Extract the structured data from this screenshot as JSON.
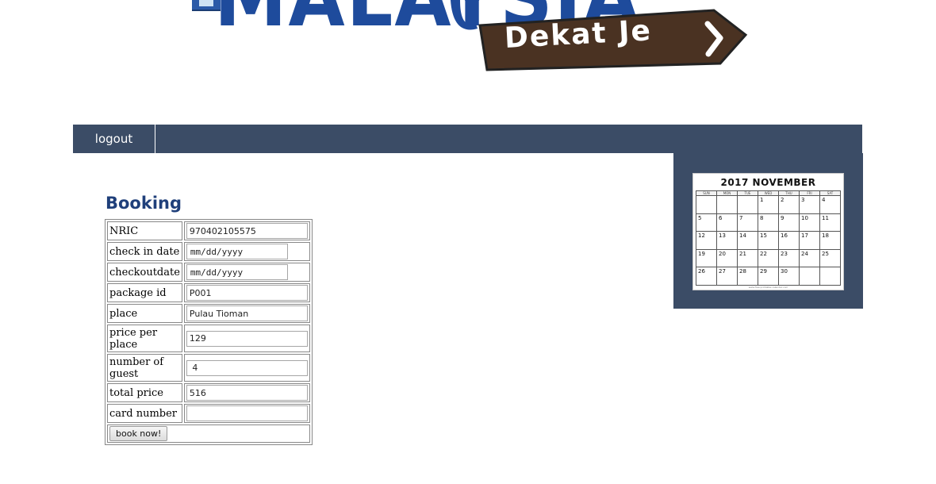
{
  "header": {
    "logo_text": "MALAYSIA",
    "sign_text": "Dekat Je"
  },
  "colors": {
    "nav_bg": "#3b4c66",
    "logo_blue": "#1e4b9c",
    "sign_brown": "#4a3222",
    "title_blue": "#1f3f7a"
  },
  "nav": {
    "items": [
      {
        "label": "logout"
      }
    ]
  },
  "sidebar": {
    "calendar": {
      "title": "2017 NOVEMBER",
      "weekdays": [
        "SUN",
        "MON",
        "TUE",
        "WED",
        "THU",
        "FRI",
        "SAT"
      ],
      "weeks": [
        [
          "",
          "",
          "",
          "1",
          "2",
          "3",
          "4"
        ],
        [
          "5",
          "6",
          "7",
          "8",
          "9",
          "10",
          "11"
        ],
        [
          "12",
          "13",
          "14",
          "15",
          "16",
          "17",
          "18"
        ],
        [
          "19",
          "20",
          "21",
          "22",
          "23",
          "24",
          "25"
        ],
        [
          "26",
          "27",
          "28",
          "29",
          "30",
          "",
          ""
        ]
      ],
      "footer": "www.free-printable-calendar.com"
    }
  },
  "booking": {
    "title": "Booking",
    "fields": [
      {
        "label": "NRIC",
        "value": "970402105575"
      },
      {
        "label": "check in date",
        "value": "mm/dd/yyyy"
      },
      {
        "label": "checkoutdate",
        "value": "mm/dd/yyyy"
      },
      {
        "label": "package id",
        "value": "P001"
      },
      {
        "label": "place",
        "value": "Pulau Tioman"
      },
      {
        "label": "price per place",
        "value": "129"
      },
      {
        "label": "number of guest",
        "value": " 4"
      },
      {
        "label": "total price",
        "value": "516"
      },
      {
        "label": "card number",
        "value": ""
      }
    ],
    "submit_label": "book now!"
  }
}
